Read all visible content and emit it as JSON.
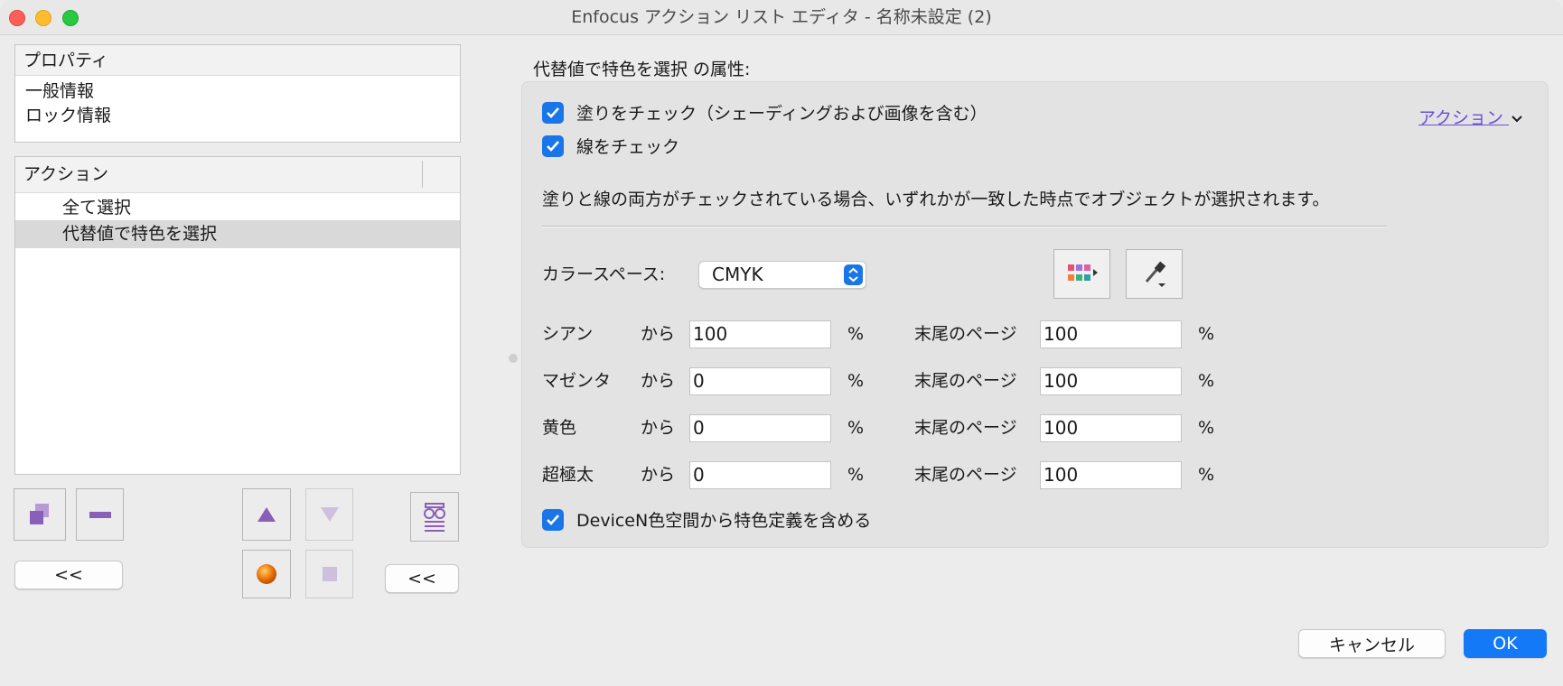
{
  "window": {
    "title": "Enfocus アクション リスト エディタ - 名称未設定 (2)"
  },
  "properties_panel": {
    "header": "プロパティ",
    "items": [
      "一般情報",
      "ロック情報"
    ]
  },
  "actions_panel": {
    "header": "アクション",
    "items": [
      {
        "label": "全て選択",
        "selected": false
      },
      {
        "label": "代替値で特色を選択",
        "selected": true
      }
    ]
  },
  "left_buttons": {
    "back_left": "<<",
    "back_right": "<<"
  },
  "heading": "代替値で特色を選択 の属性:",
  "action_menu": {
    "label": "アクション"
  },
  "checks": {
    "fill": {
      "label": "塗りをチェック（シェーディングおよび画像を含む）",
      "checked": true
    },
    "stroke": {
      "label": "線をチェック",
      "checked": true
    },
    "devicen": {
      "label": "DeviceN色空間から特色定義を含める",
      "checked": true
    }
  },
  "note": "塗りと線の両方がチェックされている場合、いずれかが一致した時点でオブジェクトが選択されます。",
  "color_space": {
    "label": "カラースペース:",
    "value": "CMYK"
  },
  "from_label": "から",
  "percent": "%",
  "to_label": "末尾のページ",
  "rows": [
    {
      "name": "シアン",
      "from": "100",
      "to": "100"
    },
    {
      "name": "マゼンタ",
      "from": "0",
      "to": "100"
    },
    {
      "name": "黄色",
      "from": "0",
      "to": "100"
    },
    {
      "name": "超極太",
      "from": "0",
      "to": "100"
    }
  ],
  "footer": {
    "cancel": "キャンセル",
    "ok": "OK"
  },
  "colors": {
    "accent": "#1479f6",
    "link": "#6a4fd8",
    "selected_row": "#d9d9d9"
  }
}
